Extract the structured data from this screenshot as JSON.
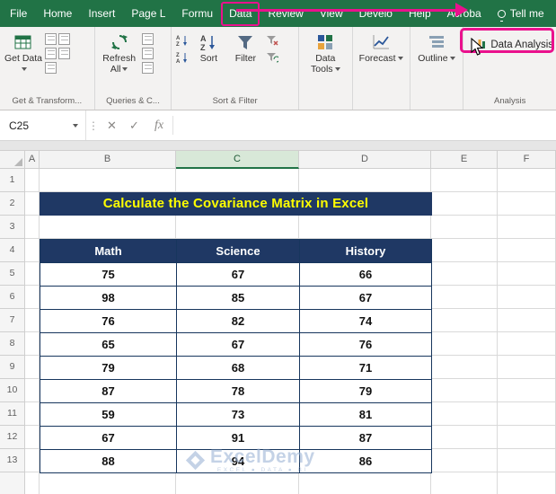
{
  "colors": {
    "ribbon_green": "#217346",
    "highlight_pink": "#ea118d",
    "navy": "#1f3864",
    "title_yellow": "#ffff00"
  },
  "icons": {
    "close": "✕",
    "check": "✓",
    "ellipsis": "⋮"
  },
  "ribbon": {
    "tabs": [
      {
        "label": "File"
      },
      {
        "label": "Home"
      },
      {
        "label": "Insert"
      },
      {
        "label": "Page L"
      },
      {
        "label": "Formu"
      },
      {
        "label": "Data",
        "highlighted": true
      },
      {
        "label": "Review"
      },
      {
        "label": "View"
      },
      {
        "label": "Develo"
      },
      {
        "label": "Help"
      },
      {
        "label": "Acroba"
      },
      {
        "label": "Tell me",
        "icon": "lightbulb"
      }
    ],
    "buttons": {
      "get_data": "Get Data",
      "refresh_all": "Refresh All",
      "sort": "Sort",
      "filter": "Filter",
      "data_tools": "Data Tools",
      "forecast": "Forecast",
      "outline": "Outline",
      "data_analysis": "Data Analysis"
    },
    "group_labels": {
      "get_transform": "Get & Transform...",
      "queries": "Queries & C...",
      "sort_filter": "Sort & Filter",
      "analysis": "Analysis"
    }
  },
  "formula_bar": {
    "name_box": "C25",
    "formula": "",
    "fx_label": "fx"
  },
  "sheet": {
    "columns": [
      "A",
      "B",
      "C",
      "D",
      "E",
      "F"
    ],
    "selected_column": "C",
    "row_numbers": [
      1,
      2,
      3,
      4,
      5,
      6,
      7,
      8,
      9,
      10,
      11,
      12,
      13
    ],
    "title": "Calculate the Covariance Matrix in Excel"
  },
  "table": {
    "headers": [
      "Math",
      "Science",
      "History"
    ],
    "rows": [
      [
        "75",
        "67",
        "66"
      ],
      [
        "98",
        "85",
        "67"
      ],
      [
        "76",
        "82",
        "74"
      ],
      [
        "65",
        "67",
        "76"
      ],
      [
        "79",
        "68",
        "71"
      ],
      [
        "87",
        "78",
        "79"
      ],
      [
        "59",
        "73",
        "81"
      ],
      [
        "67",
        "91",
        "87"
      ],
      [
        "88",
        "94",
        "86"
      ]
    ]
  },
  "watermark": {
    "brand": "ExcelDemy",
    "tagline": "EXCEL ● DATA ● BI"
  }
}
